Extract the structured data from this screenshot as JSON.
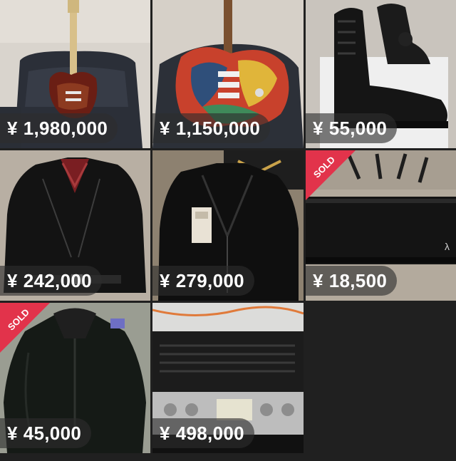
{
  "items": [
    {
      "price": "1,980,000",
      "sold": false,
      "subject": "electric-guitar"
    },
    {
      "price": "1,150,000",
      "sold": false,
      "subject": "painted-electric-guitar"
    },
    {
      "price": "55,000",
      "sold": false,
      "subject": "black-leather-boots"
    },
    {
      "price": "242,000",
      "sold": false,
      "subject": "leather-motorcycle-jacket"
    },
    {
      "price": "279,000",
      "sold": false,
      "subject": "leather-rider-jacket"
    },
    {
      "price": "18,500",
      "sold": true,
      "subject": "black-case"
    },
    {
      "price": "45,000",
      "sold": true,
      "subject": "shearling-leather-jacket"
    },
    {
      "price": "498,000",
      "sold": false,
      "subject": "audio-preamp"
    }
  ],
  "currency_symbol": "¥",
  "sold_label": "SOLD",
  "colors": {
    "sold_ribbon": "#e2334b",
    "background": "#202020"
  }
}
